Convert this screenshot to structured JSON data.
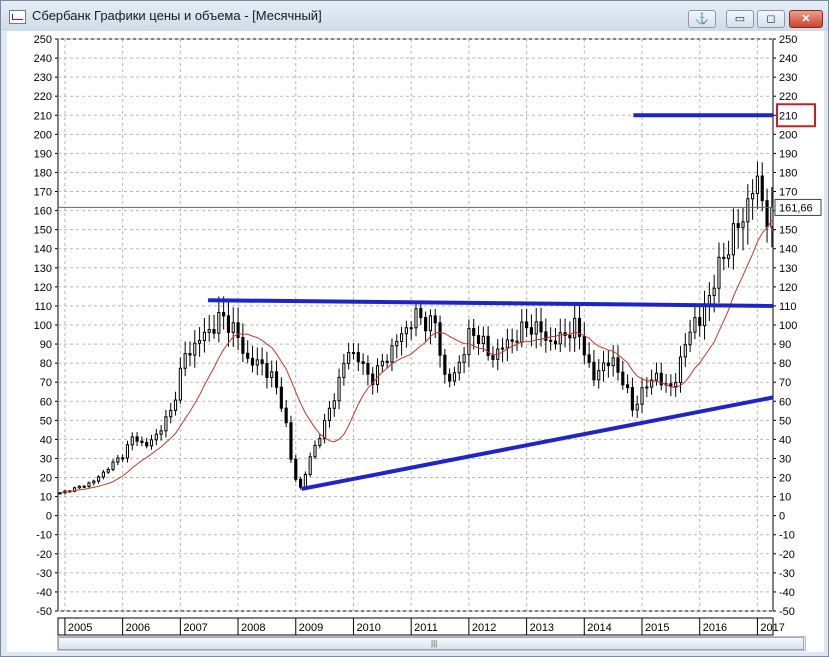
{
  "window": {
    "title": "Сбербанк Графики цены и объема - [Месячный]",
    "buttons": {
      "anchor": "⚓",
      "minimize": "▭",
      "maximize": "◻",
      "close": "✕"
    }
  },
  "chart_data": {
    "type": "candlestick",
    "title": "Сбербанк Графики цены и объема - [Месячный]",
    "period": "monthly",
    "ylim": [
      -50,
      250
    ],
    "y_ticks": [
      250,
      240,
      230,
      220,
      210,
      200,
      190,
      180,
      170,
      160,
      150,
      140,
      130,
      120,
      110,
      100,
      90,
      80,
      70,
      60,
      50,
      40,
      30,
      20,
      10,
      0,
      -10,
      -20,
      -30,
      -40,
      -50
    ],
    "x_labels": [
      "2005",
      "2006",
      "2007",
      "2008",
      "2009",
      "2010",
      "2011",
      "2012",
      "2013",
      "2014",
      "2015",
      "2016",
      "2017"
    ],
    "x_range": [
      2004.88,
      2017.27
    ],
    "grid": true,
    "last_price_label": "161,66",
    "last_price": 161.66,
    "marked_level_label": "210",
    "marked_level": 210,
    "close_anchors": [
      [
        2004.92,
        12
      ],
      [
        2005.25,
        15
      ],
      [
        2005.5,
        18
      ],
      [
        2005.75,
        25
      ],
      [
        2006.0,
        32
      ],
      [
        2006.2,
        42
      ],
      [
        2006.4,
        36
      ],
      [
        2006.6,
        43
      ],
      [
        2006.85,
        55
      ],
      [
        2007.05,
        82
      ],
      [
        2007.2,
        88
      ],
      [
        2007.35,
        93
      ],
      [
        2007.5,
        97
      ],
      [
        2007.7,
        104
      ],
      [
        2007.9,
        100
      ],
      [
        2008.0,
        92
      ],
      [
        2008.2,
        80
      ],
      [
        2008.4,
        80
      ],
      [
        2008.6,
        72
      ],
      [
        2008.8,
        55
      ],
      [
        2008.95,
        22
      ],
      [
        2009.1,
        14
      ],
      [
        2009.2,
        26
      ],
      [
        2009.35,
        38
      ],
      [
        2009.5,
        48
      ],
      [
        2009.7,
        66
      ],
      [
        2009.9,
        86
      ],
      [
        2010.05,
        85
      ],
      [
        2010.2,
        75
      ],
      [
        2010.35,
        72
      ],
      [
        2010.5,
        80
      ],
      [
        2010.7,
        89
      ],
      [
        2010.9,
        98
      ],
      [
        2011.1,
        105
      ],
      [
        2011.3,
        101
      ],
      [
        2011.45,
        100
      ],
      [
        2011.55,
        74
      ],
      [
        2011.7,
        70
      ],
      [
        2011.85,
        82
      ],
      [
        2012.0,
        94
      ],
      [
        2012.2,
        95
      ],
      [
        2012.35,
        82
      ],
      [
        2012.55,
        88
      ],
      [
        2012.75,
        92
      ],
      [
        2012.95,
        98
      ],
      [
        2013.1,
        100
      ],
      [
        2013.25,
        96
      ],
      [
        2013.45,
        90
      ],
      [
        2013.65,
        95
      ],
      [
        2013.85,
        99
      ],
      [
        2014.0,
        88
      ],
      [
        2014.15,
        70
      ],
      [
        2014.3,
        80
      ],
      [
        2014.5,
        80
      ],
      [
        2014.65,
        73
      ],
      [
        2014.75,
        64
      ],
      [
        2014.85,
        54
      ],
      [
        2014.95,
        64
      ],
      [
        2015.1,
        68
      ],
      [
        2015.25,
        75
      ],
      [
        2015.4,
        66
      ],
      [
        2015.55,
        70
      ],
      [
        2015.7,
        82
      ],
      [
        2015.8,
        98
      ],
      [
        2015.9,
        102
      ],
      [
        2016.0,
        100
      ],
      [
        2016.1,
        112
      ],
      [
        2016.25,
        122
      ],
      [
        2016.45,
        140
      ],
      [
        2016.6,
        147
      ],
      [
        2016.75,
        158
      ],
      [
        2016.9,
        168
      ],
      [
        2016.98,
        177
      ],
      [
        2017.1,
        166
      ],
      [
        2017.2,
        150
      ],
      [
        2017.27,
        161.66
      ]
    ],
    "moving_average": {
      "name": "",
      "color": "#c0392b",
      "period_months": 12
    },
    "trendlines": [
      {
        "from": [
          2007.48,
          113
        ],
        "to": [
          2017.27,
          110
        ],
        "color": "#1f24c7"
      },
      {
        "from": [
          2009.1,
          14
        ],
        "to": [
          2017.27,
          62
        ],
        "color": "#1f24c7"
      },
      {
        "from": [
          2014.85,
          210
        ],
        "to": [
          2017.27,
          210
        ],
        "color": "#1f24c7"
      }
    ]
  }
}
